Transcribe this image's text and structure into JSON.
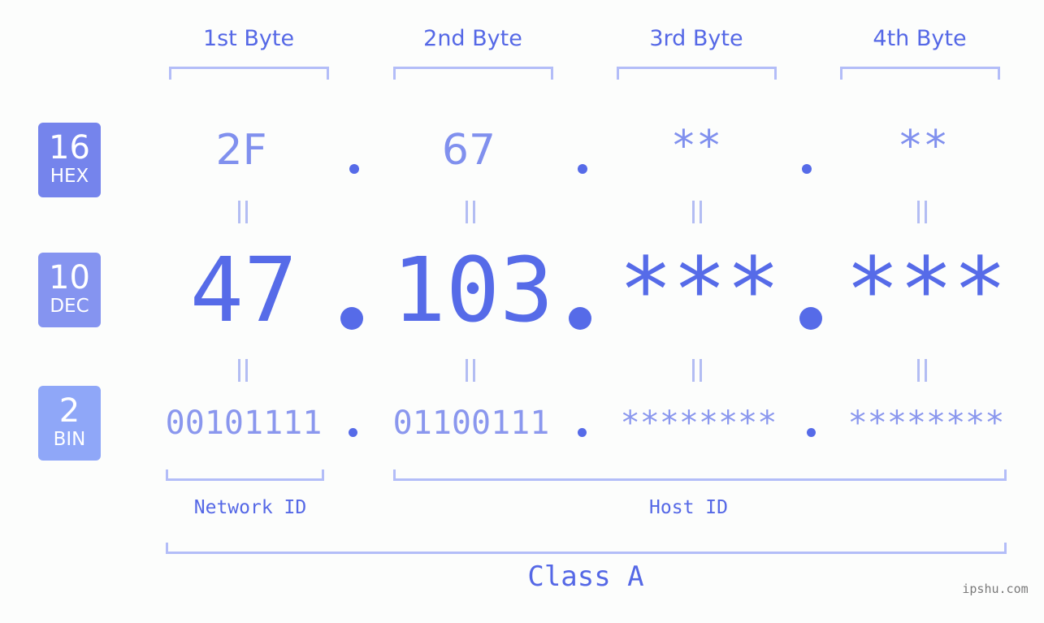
{
  "byte_headers": [
    "1st Byte",
    "2nd Byte",
    "3rd Byte",
    "4th Byte"
  ],
  "bases": [
    {
      "number": "16",
      "label": "HEX",
      "color": "#7584ec"
    },
    {
      "number": "10",
      "label": "DEC",
      "color": "#8594f0"
    },
    {
      "number": "2",
      "label": "BIN",
      "color": "#8fa7f8"
    }
  ],
  "hex_octets": [
    "2F",
    "67",
    "**",
    "**"
  ],
  "dec_octets": [
    "47",
    "103",
    "***",
    "***"
  ],
  "bin_octets": [
    "00101111",
    "01100111",
    "********",
    "********"
  ],
  "separator": ".",
  "equals_symbol": "=",
  "segments": {
    "network_id": "Network ID",
    "host_id": "Host ID"
  },
  "ip_class": "Class A",
  "watermark": "ipshu.com",
  "colors": {
    "accent": "#566be8",
    "hex_text": "#8090ee",
    "bin_text": "#8a97ee",
    "bracket": "#b3bdf8"
  }
}
